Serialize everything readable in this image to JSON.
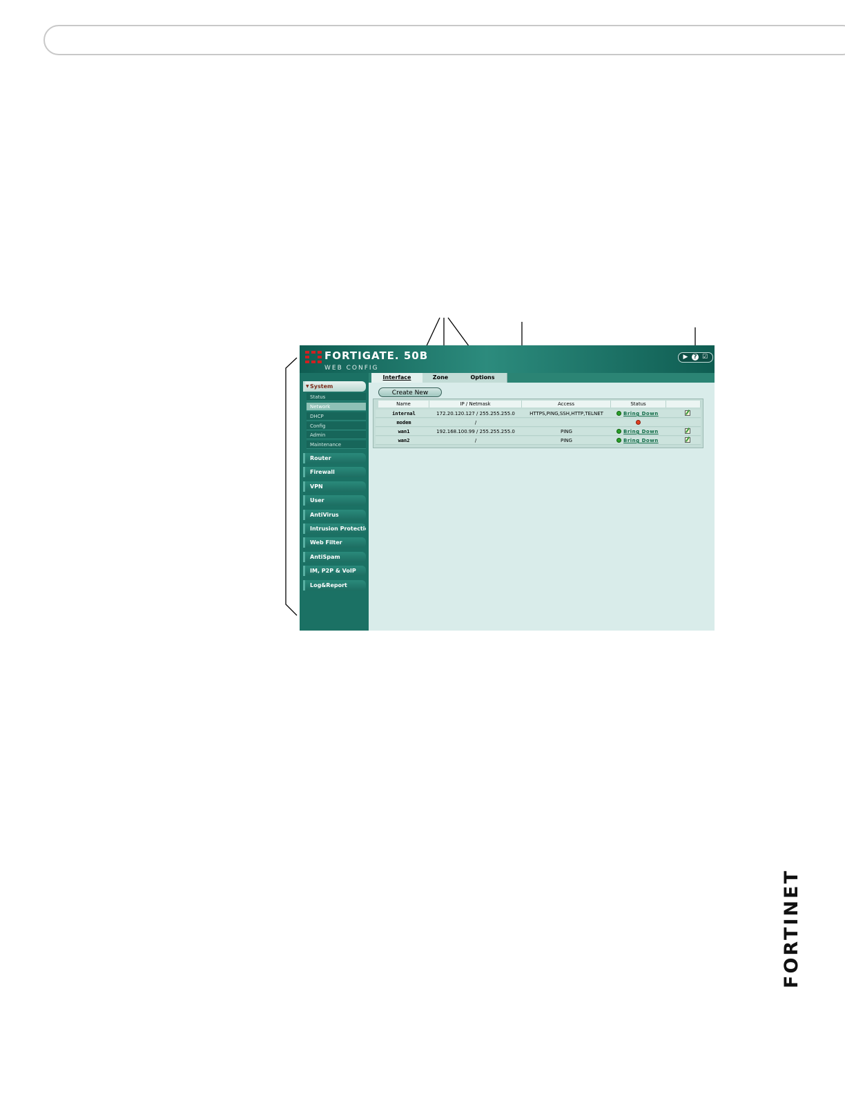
{
  "app": {
    "brand": "FORTIGATE. 50B",
    "subtitle": "WEB CONFIG"
  },
  "tabs": [
    {
      "label": "Interface",
      "active": true
    },
    {
      "label": "Zone",
      "active": false
    },
    {
      "label": "Options",
      "active": false
    }
  ],
  "sidebar": {
    "sections": [
      {
        "label": "System",
        "expanded": true
      },
      {
        "label": "Router"
      },
      {
        "label": "Firewall"
      },
      {
        "label": "VPN"
      },
      {
        "label": "User"
      },
      {
        "label": "AntiVirus"
      },
      {
        "label": "Intrusion Protection"
      },
      {
        "label": "Web Filter"
      },
      {
        "label": "AntiSpam"
      },
      {
        "label": "IM, P2P & VoIP"
      },
      {
        "label": "Log&Report"
      }
    ],
    "system_items": [
      {
        "label": "Status"
      },
      {
        "label": "Network",
        "active": true
      },
      {
        "label": "DHCP"
      },
      {
        "label": "Config"
      },
      {
        "label": "Admin"
      },
      {
        "label": "Maintenance"
      }
    ]
  },
  "toolbar": {
    "create_label": "Create New",
    "icons": [
      "console-icon",
      "help-icon",
      "logout-icon"
    ]
  },
  "table": {
    "headers": [
      "Name",
      "IP / Netmask",
      "Access",
      "Status",
      ""
    ],
    "rows": [
      {
        "name": "internal",
        "ip": "172.20.120.127 / 255.255.255.0",
        "access": "HTTPS,PING,SSH,HTTP,TELNET",
        "status": "up",
        "action": "Bring Down",
        "editable": true
      },
      {
        "name": "modem",
        "ip": "/",
        "access": "",
        "status": "down",
        "action": "",
        "editable": false
      },
      {
        "name": "wan1",
        "ip": "192.168.100.99 / 255.255.255.0",
        "access": "PING",
        "status": "up",
        "action": "Bring Down",
        "editable": true
      },
      {
        "name": "wan2",
        "ip": "/",
        "access": "PING",
        "status": "up",
        "action": "Bring Down",
        "editable": true
      }
    ]
  },
  "footer_logo": "FORTINET",
  "colors": {
    "accent": "#1e7a6e",
    "content_bg": "#d9ecea",
    "brand_red": "#d02020"
  }
}
